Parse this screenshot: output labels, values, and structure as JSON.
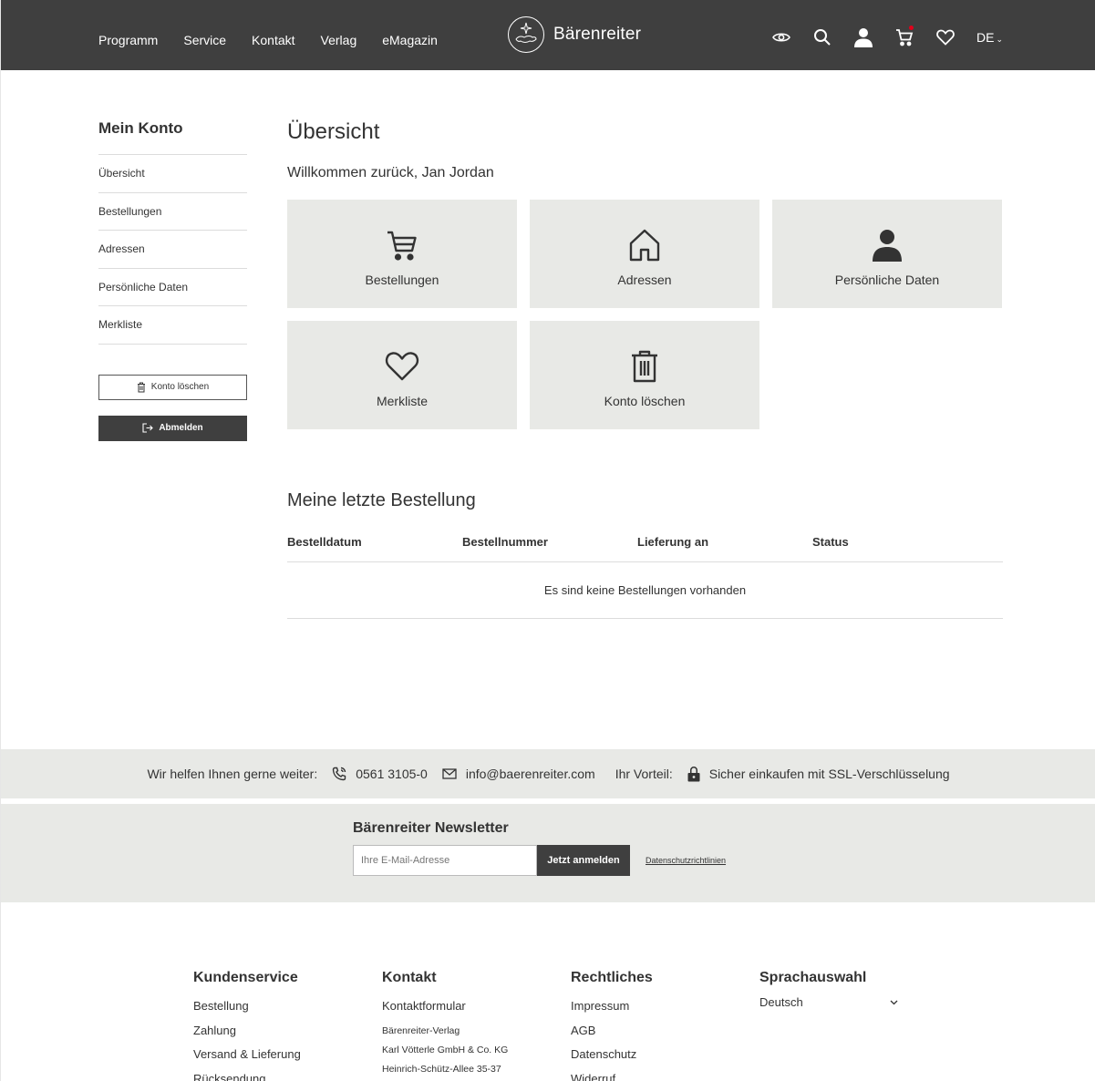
{
  "header": {
    "nav": [
      "Programm",
      "Service",
      "Kontakt",
      "Verlag",
      "eMagazin"
    ],
    "logo_text": "Bärenreiter",
    "language": "DE",
    "icons": [
      "eye-icon",
      "search-icon",
      "user-icon",
      "cart-icon",
      "heart-icon"
    ],
    "cart_badge_color": "#e1001a"
  },
  "sidebar": {
    "title": "Mein Konto",
    "items": [
      "Übersicht",
      "Bestellungen",
      "Adressen",
      "Persönliche Daten",
      "Merkliste"
    ],
    "delete_label": "Konto löschen",
    "logout_label": "Abmelden"
  },
  "main": {
    "title": "Übersicht",
    "welcome": "Willkommen zurück, Jan Jordan",
    "tiles": [
      {
        "label": "Bestellungen",
        "icon": "cart-icon"
      },
      {
        "label": "Adressen",
        "icon": "home-icon"
      },
      {
        "label": "Persönliche Daten",
        "icon": "user-icon"
      },
      {
        "label": "Merkliste",
        "icon": "heart-icon"
      },
      {
        "label": "Konto löschen",
        "icon": "trash-icon"
      }
    ],
    "orders": {
      "title": "Meine letzte Bestellung",
      "columns": [
        "Bestelldatum",
        "Bestellnummer",
        "Lieferung an",
        "Status"
      ],
      "empty": "Es sind keine Bestellungen vorhanden"
    }
  },
  "service_bar": {
    "help_label": "Wir helfen Ihnen gerne weiter:",
    "phone": "0561 3105-0",
    "email": "info@baerenreiter.com",
    "advantage_label": "Ihr Vorteil:",
    "ssl_text": "Sicher einkaufen mit SSL-Verschlüsselung"
  },
  "newsletter": {
    "title": "Bärenreiter Newsletter",
    "placeholder": "Ihre E-Mail-Adresse",
    "button": "Jetzt anmelden",
    "privacy_link": "Datenschutzrichtlinien"
  },
  "footer": {
    "customer_service": {
      "title": "Kundenservice",
      "links": [
        "Bestellung",
        "Zahlung",
        "Versand & Lieferung",
        "Rücksendung"
      ]
    },
    "contact": {
      "title": "Kontakt",
      "link": "Kontaktformular",
      "address": [
        "Bärenreiter-Verlag",
        "Karl Vötterle GmbH & Co. KG",
        "Heinrich-Schütz-Allee 35-37"
      ]
    },
    "legal": {
      "title": "Rechtliches",
      "links": [
        "Impressum",
        "AGB",
        "Datenschutz",
        "Widerruf"
      ]
    },
    "language": {
      "title": "Sprachauswahl",
      "selected": "Deutsch"
    }
  }
}
